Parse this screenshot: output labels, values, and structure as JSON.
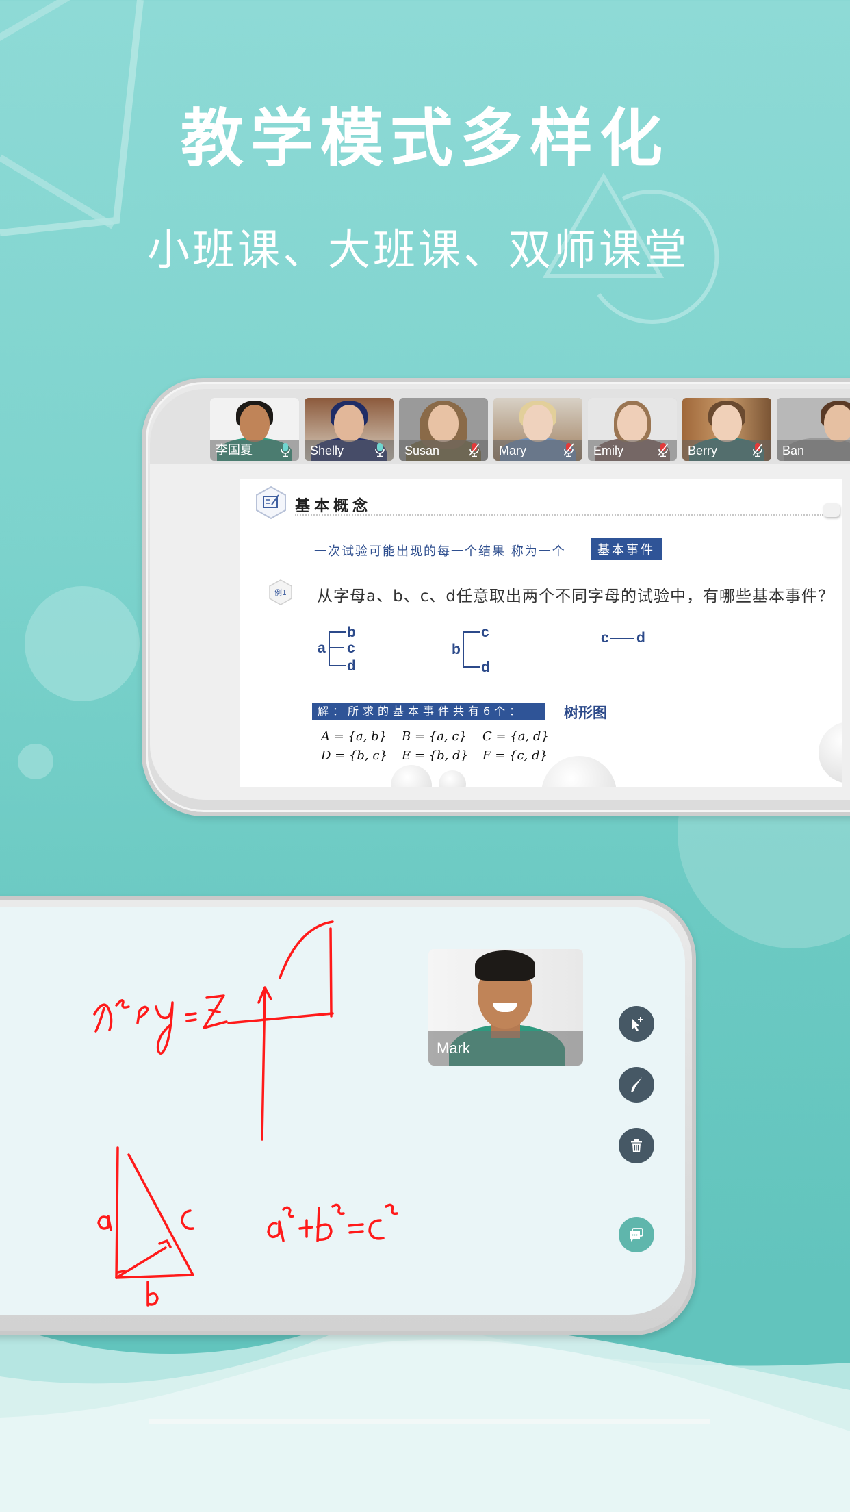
{
  "promo": {
    "headline": "教学模式多样化",
    "subline": "小班课、大班课、双师课堂"
  },
  "colors": {
    "background_teal": "#7dd3cd",
    "slide_blue": "#2f5497",
    "mic_on": "#6fd6d0",
    "mic_off": "#e23a3a",
    "tool_button": "#465865",
    "chat_button": "#5fb6ac",
    "ink_red": "#ff1a1a"
  },
  "classroom": {
    "participants": [
      {
        "name": "李国夏",
        "mic": "on"
      },
      {
        "name": "Shelly",
        "mic": "on"
      },
      {
        "name": "Susan",
        "mic": "muted"
      },
      {
        "name": "Mary",
        "mic": "muted"
      },
      {
        "name": "Emily",
        "mic": "muted"
      },
      {
        "name": "Berry",
        "mic": "muted"
      },
      {
        "name": "Ban",
        "mic": "none"
      }
    ],
    "slide": {
      "section_title": "基本概念",
      "definition": "一次试验可能出现的每一个结果 称为一个",
      "term": "基本事件",
      "example_label": "例1",
      "question": "从字母a、b、c、d任意取出两个不同字母的试验中，有哪些基本事件？",
      "trees": [
        {
          "root": "a",
          "leaves": [
            "b",
            "c",
            "d"
          ]
        },
        {
          "root": "b",
          "leaves": [
            "c",
            "d"
          ]
        },
        {
          "root": "c",
          "leaves": [
            "d"
          ]
        }
      ],
      "answer_label": "解：所求的基本事件共有6个：",
      "tree_caption": "树形图",
      "sets": [
        [
          "A = {a, b}",
          "B = {a, c}",
          "C = {a, d}"
        ],
        [
          "D = {b, c}",
          "E = {b, d}",
          "F = {c, d}"
        ]
      ]
    }
  },
  "whiteboard": {
    "teacher_name": "Mark",
    "handwriting": {
      "equation_1": "x²+y = z",
      "equation_2": "a²+b²=c²",
      "triangle_labels": [
        "a",
        "b",
        "c"
      ]
    },
    "tools": [
      {
        "icon": "cursor-plus-icon",
        "label": "Pointer"
      },
      {
        "icon": "brush-icon",
        "label": "Brush"
      },
      {
        "icon": "trash-icon",
        "label": "Clear"
      },
      {
        "icon": "chat-icon",
        "label": "Chat"
      }
    ]
  }
}
